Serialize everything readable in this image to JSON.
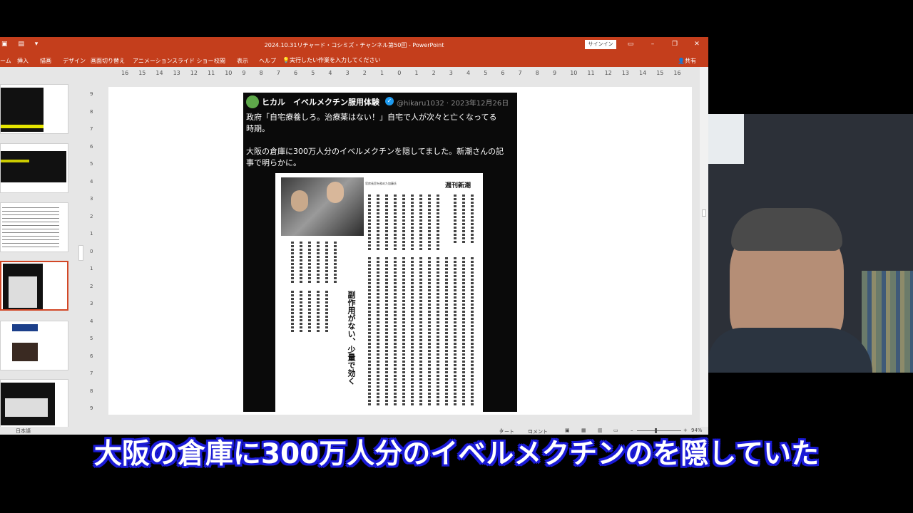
{
  "window": {
    "title": "2024.10.31リチャード・コシミズ・チャンネル第50回 - PowerPoint",
    "signin_label": "サインイン",
    "share_label": "共有",
    "tell_me": "実行したい作業を入力してください"
  },
  "ribbon_tabs": [
    "ーム",
    "挿入",
    "描画",
    "デザイン",
    "画面切り替え",
    "アニメーション",
    "スライド ショー",
    "校閲",
    "表示",
    "ヘルプ"
  ],
  "ruler_h": [
    "16",
    "15",
    "14",
    "13",
    "12",
    "11",
    "10",
    "9",
    "8",
    "7",
    "6",
    "5",
    "4",
    "3",
    "2",
    "1",
    "0",
    "1",
    "2",
    "3",
    "4",
    "5",
    "6",
    "7",
    "8",
    "9",
    "10",
    "11",
    "12",
    "13",
    "14",
    "15",
    "16"
  ],
  "ruler_v": [
    "9",
    "8",
    "7",
    "6",
    "5",
    "4",
    "3",
    "2",
    "1",
    "0",
    "1",
    "2",
    "3",
    "4",
    "5",
    "6",
    "7",
    "8",
    "9"
  ],
  "tweet": {
    "name": "ヒカル　イベルメクチン服用体験",
    "badge": "✓",
    "handle": "@hikaru1032 · 2023年12月26日",
    "lines": [
      "政府「自宅療養しろ。治療薬はない！」自宅で人が次々と亡くなってる",
      "時期。",
      "大阪の倉庫に300万人分のイベルメクチンを隠してました。新潮さんの記",
      "事で明らかに。"
    ]
  },
  "article": {
    "magazine": "週刊新潮",
    "caption": "官房長官を務めた加藤氏",
    "headline": "副作用がない、少量で効く"
  },
  "status": {
    "language": "日本語",
    "notes": "ノート",
    "comments": "コメント",
    "zoom": "94%"
  },
  "subtitle": "大阪の倉庫に300万人分のイベルメクチンのを隠していた",
  "colors": {
    "ribbon": "#c43e1c",
    "subtitle_outline": "#1a1ad6"
  }
}
